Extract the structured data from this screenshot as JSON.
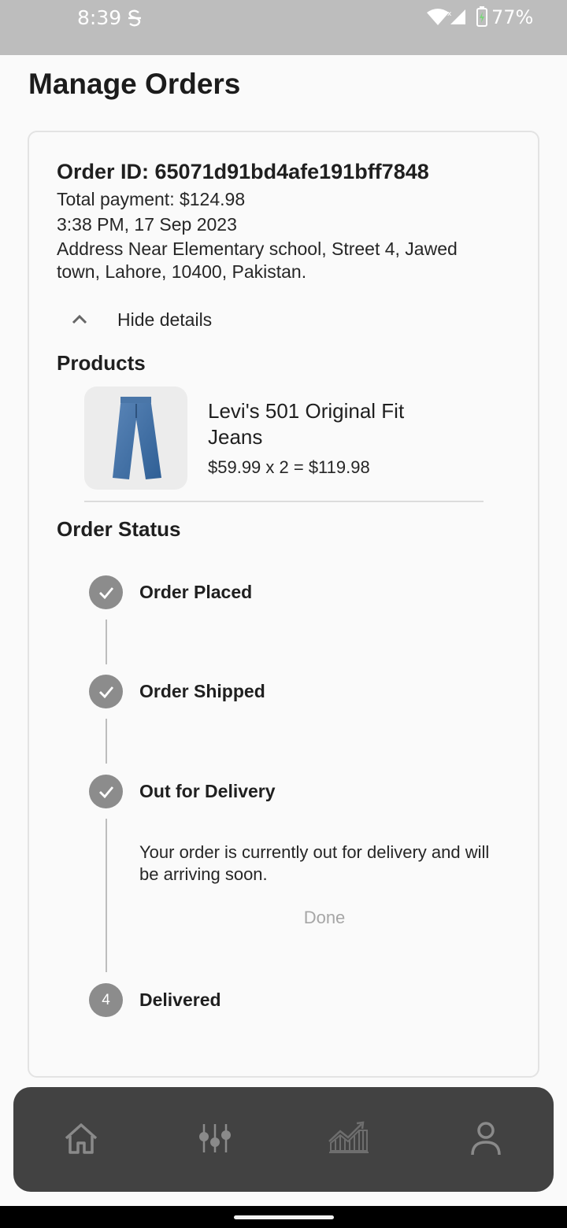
{
  "status_bar": {
    "time": "8:39",
    "battery": "77%"
  },
  "page": {
    "title": "Manage Orders"
  },
  "order": {
    "id_text": "Order ID: 65071d91bd4afe191bff7848",
    "total_payment": "Total payment: $124.98",
    "datetime": "3:38 PM, 17 Sep 2023",
    "address": "Address Near Elementary school, Street 4, Jawed town, Lahore, 10400, Pakistan.",
    "toggle_label": "Hide details",
    "products_title": "Products",
    "products": [
      {
        "name": "Levi's 501 Original Fit Jeans",
        "price_line": "$59.99 x 2 = $119.98"
      }
    ],
    "status_title": "Order Status",
    "steps": [
      {
        "label": "Order Placed",
        "completed": true
      },
      {
        "label": "Order Shipped",
        "completed": true
      },
      {
        "label": "Out for Delivery",
        "completed": true,
        "message": "Your order is currently out for delivery and will be arriving soon.",
        "button": "Done"
      },
      {
        "label": "Delivered",
        "completed": false,
        "number": "4"
      }
    ]
  },
  "bottom_nav": [
    {
      "icon": "home-icon"
    },
    {
      "icon": "sliders-icon"
    },
    {
      "icon": "chart-icon"
    },
    {
      "icon": "profile-icon"
    }
  ],
  "colors": {
    "status_bar_bg": "#bdbdbd",
    "step_icon_bg": "#8c8c8c",
    "nav_bg": "#424242",
    "nav_icon": "#8a8a8a"
  }
}
